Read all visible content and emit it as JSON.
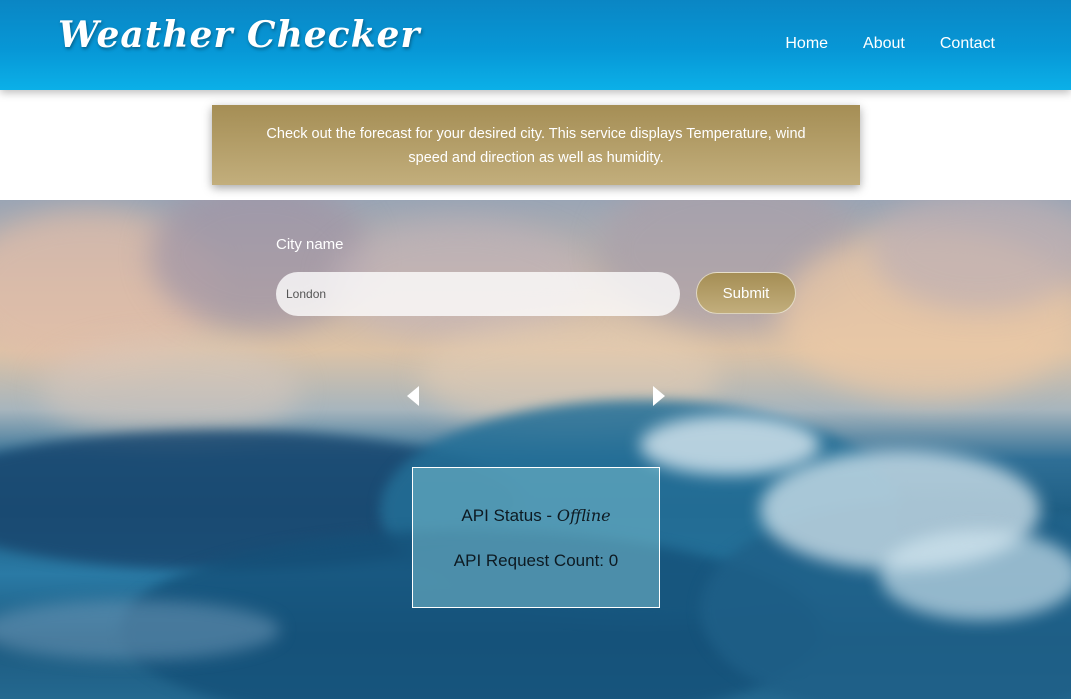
{
  "header": {
    "logo_text": "Weather Checker",
    "nav": [
      {
        "label": "Home"
      },
      {
        "label": "About"
      },
      {
        "label": "Contact"
      }
    ]
  },
  "intro": {
    "text": "Check out the forecast for your desired city. This service displays Temperature, wind speed and direction as well as humidity."
  },
  "form": {
    "city_label": "City name",
    "city_value": "London",
    "submit_label": "Submit"
  },
  "carousel": {
    "prev_icon": "caret-left-icon",
    "next_icon": "caret-right-icon"
  },
  "status": {
    "api_status_label": "API Status - ",
    "api_status_value": "Offline",
    "request_count_label": "API Request Count: ",
    "request_count_value": "0"
  },
  "colors": {
    "header_blue": "#0797d6",
    "accent_gold": "#b39e66"
  }
}
